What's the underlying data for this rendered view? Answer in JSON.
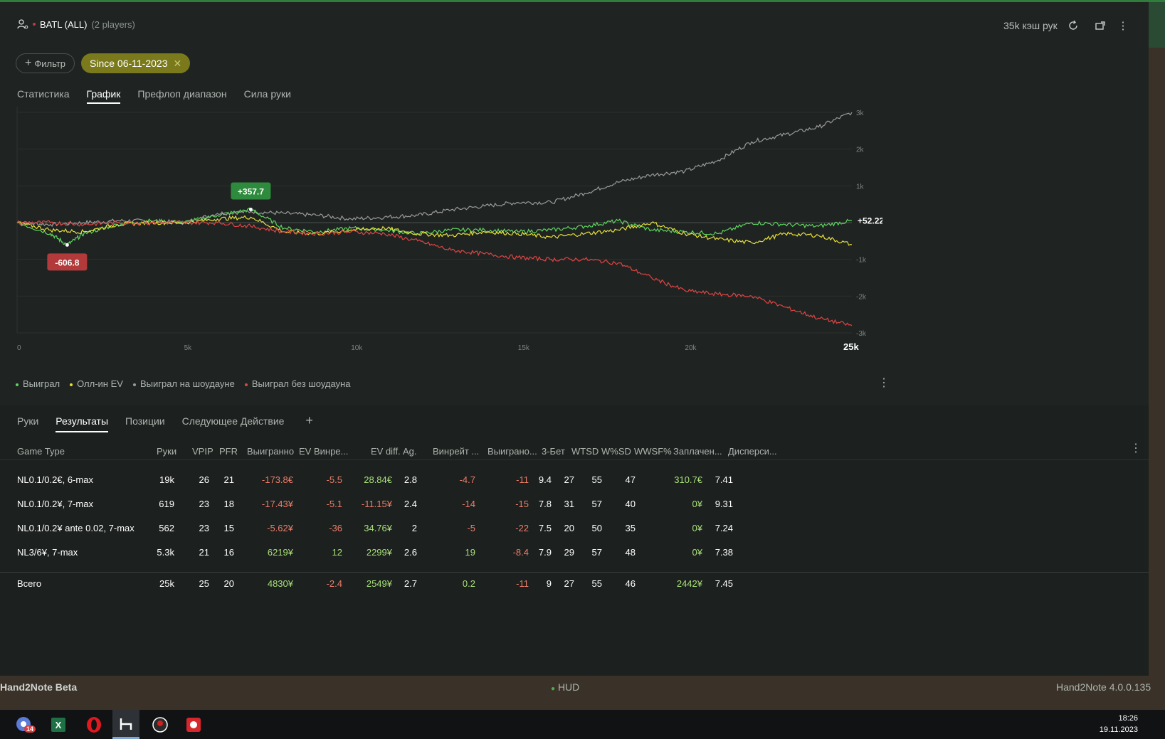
{
  "header": {
    "player_name": "BATL (ALL)",
    "player_count": "(2 players)",
    "hands_cache": "35k кэш рук"
  },
  "filters": {
    "add_filter": "Фильтр",
    "since_chip": "Since 06-11-2023"
  },
  "main_tabs": [
    {
      "label": "Статистика"
    },
    {
      "label": "График"
    },
    {
      "label": "Префлоп диапазон"
    },
    {
      "label": "Сила руки"
    }
  ],
  "chart_data": {
    "type": "line",
    "x_ticks": [
      "0",
      "5k",
      "10k",
      "15k",
      "20k",
      "25k"
    ],
    "y_ticks": [
      "3k",
      "2k",
      "1k",
      "-1k",
      "-2k",
      "-3k"
    ],
    "xlim": [
      0,
      25000
    ],
    "ylim": [
      -3000,
      3000
    ],
    "max_label": "+357.7",
    "min_label": "-606.8",
    "current_label": "+52.22",
    "series": [
      {
        "name": "Выиграл на шоудауне",
        "color": "#9a9a9a",
        "x": [
          0,
          1000,
          2000,
          3000,
          4000,
          5000,
          6000,
          7000,
          8000,
          9000,
          10000,
          11000,
          12000,
          13000,
          14000,
          15000,
          16000,
          17000,
          18000,
          19000,
          20000,
          21000,
          22000,
          23000,
          24000,
          25000
        ],
        "values": [
          0,
          -50,
          0,
          50,
          50,
          0,
          250,
          300,
          250,
          200,
          100,
          150,
          200,
          350,
          450,
          550,
          550,
          800,
          1100,
          1300,
          1400,
          1700,
          2200,
          2400,
          2600,
          3000
        ]
      },
      {
        "name": "Выиграл",
        "color": "#5fd45f",
        "x": [
          0,
          1000,
          1500,
          2000,
          3000,
          4000,
          5000,
          6000,
          7000,
          8000,
          9000,
          10000,
          11000,
          12000,
          13000,
          14000,
          15000,
          16000,
          17000,
          18000,
          19000,
          20000,
          21000,
          22000,
          23000,
          24000,
          25000
        ],
        "values": [
          0,
          -300,
          -606.8,
          -300,
          -50,
          50,
          0,
          200,
          357.7,
          -150,
          -250,
          -150,
          -200,
          -300,
          -200,
          -200,
          -250,
          -200,
          -100,
          50,
          -200,
          -250,
          -300,
          0,
          -50,
          -100,
          52.22
        ]
      },
      {
        "name": "Олл-ин EV",
        "color": "#e6df3a",
        "x": [
          0,
          1000,
          2000,
          3000,
          4000,
          5000,
          6000,
          7000,
          8000,
          9000,
          10000,
          11000,
          12000,
          13000,
          14000,
          15000,
          16000,
          17000,
          18000,
          19000,
          20000,
          21000,
          22000,
          23000,
          24000,
          25000
        ],
        "values": [
          0,
          -200,
          -250,
          -50,
          0,
          0,
          100,
          150,
          -250,
          -300,
          -200,
          -150,
          -300,
          -350,
          -250,
          -300,
          -400,
          -300,
          -200,
          0,
          -300,
          -450,
          -550,
          -300,
          -350,
          -600
        ]
      },
      {
        "name": "Выиграл без шоудауна",
        "color": "#e04444",
        "x": [
          0,
          1000,
          2000,
          3000,
          4000,
          5000,
          6000,
          7000,
          8000,
          9000,
          10000,
          11000,
          12000,
          13000,
          14000,
          15000,
          16000,
          17000,
          18000,
          19000,
          20000,
          21000,
          22000,
          23000,
          24000,
          25000
        ],
        "values": [
          0,
          0,
          -50,
          0,
          0,
          0,
          0,
          -100,
          -250,
          -300,
          -250,
          -300,
          -500,
          -750,
          -850,
          -950,
          -1000,
          -1000,
          -1100,
          -1500,
          -1850,
          -1950,
          -2000,
          -2300,
          -2600,
          -2800
        ]
      }
    ]
  },
  "legend": [
    {
      "label": "Выиграл",
      "color": "#5fd45f"
    },
    {
      "label": "Олл-ин EV",
      "color": "#e6df3a"
    },
    {
      "label": "Выиграл на шоудауне",
      "color": "#9a9a9a"
    },
    {
      "label": "Выиграл без шоудауна",
      "color": "#e04444"
    }
  ],
  "sub_tabs": [
    {
      "label": "Руки"
    },
    {
      "label": "Результаты"
    },
    {
      "label": "Позиции"
    },
    {
      "label": "Следующее Действие"
    }
  ],
  "table": {
    "columns": [
      "Game Type",
      "Руки",
      "VPIP",
      "PFR",
      "Выигранно",
      "EV Винре...",
      "EV diff.",
      "Ag.",
      "Винрейт ...",
      "Выиграно...",
      "3-Бет",
      "WTSD",
      "W%SD",
      "WWSF%",
      "Заплачен...",
      "Дисперси..."
    ],
    "rows": [
      [
        "NL0.1/0.2€, 6-max",
        "19k",
        "26",
        "21",
        "-173.8€",
        "-5.5",
        "28.84€",
        "2.8",
        "-4.7",
        "-11",
        "9.4",
        "27",
        "55",
        "47",
        "310.7€",
        "7.41"
      ],
      [
        "NL0.1/0.2¥, 7-max",
        "619",
        "23",
        "18",
        "-17.43¥",
        "-5.1",
        "-11.15¥",
        "2.4",
        "-14",
        "-15",
        "7.8",
        "31",
        "57",
        "40",
        "0¥",
        "9.31"
      ],
      [
        "NL0.1/0.2¥ ante 0.02, 7-max",
        "562",
        "23",
        "15",
        "-5.62¥",
        "-36",
        "34.76¥",
        "2",
        "-5",
        "-22",
        "7.5",
        "20",
        "50",
        "35",
        "0¥",
        "7.24"
      ],
      [
        "NL3/6¥, 7-max",
        "5.3k",
        "21",
        "16",
        "6219¥",
        "12",
        "2299¥",
        "2.6",
        "19",
        "-8.4",
        "7.9",
        "29",
        "57",
        "48",
        "0¥",
        "7.38"
      ]
    ],
    "total": [
      "Всего",
      "25k",
      "25",
      "20",
      "4830¥",
      "-2.4",
      "2549¥",
      "2.7",
      "0.2",
      "-11",
      "9",
      "27",
      "55",
      "46",
      "2442¥",
      "7.45"
    ]
  },
  "status_bar": {
    "app_name": "Hand2Note Beta",
    "hud": "HUD",
    "version": "Hand2Note 4.0.0.135"
  },
  "taskbar": {
    "badge": "14",
    "time": "18:26",
    "date": "19.11.2023"
  }
}
